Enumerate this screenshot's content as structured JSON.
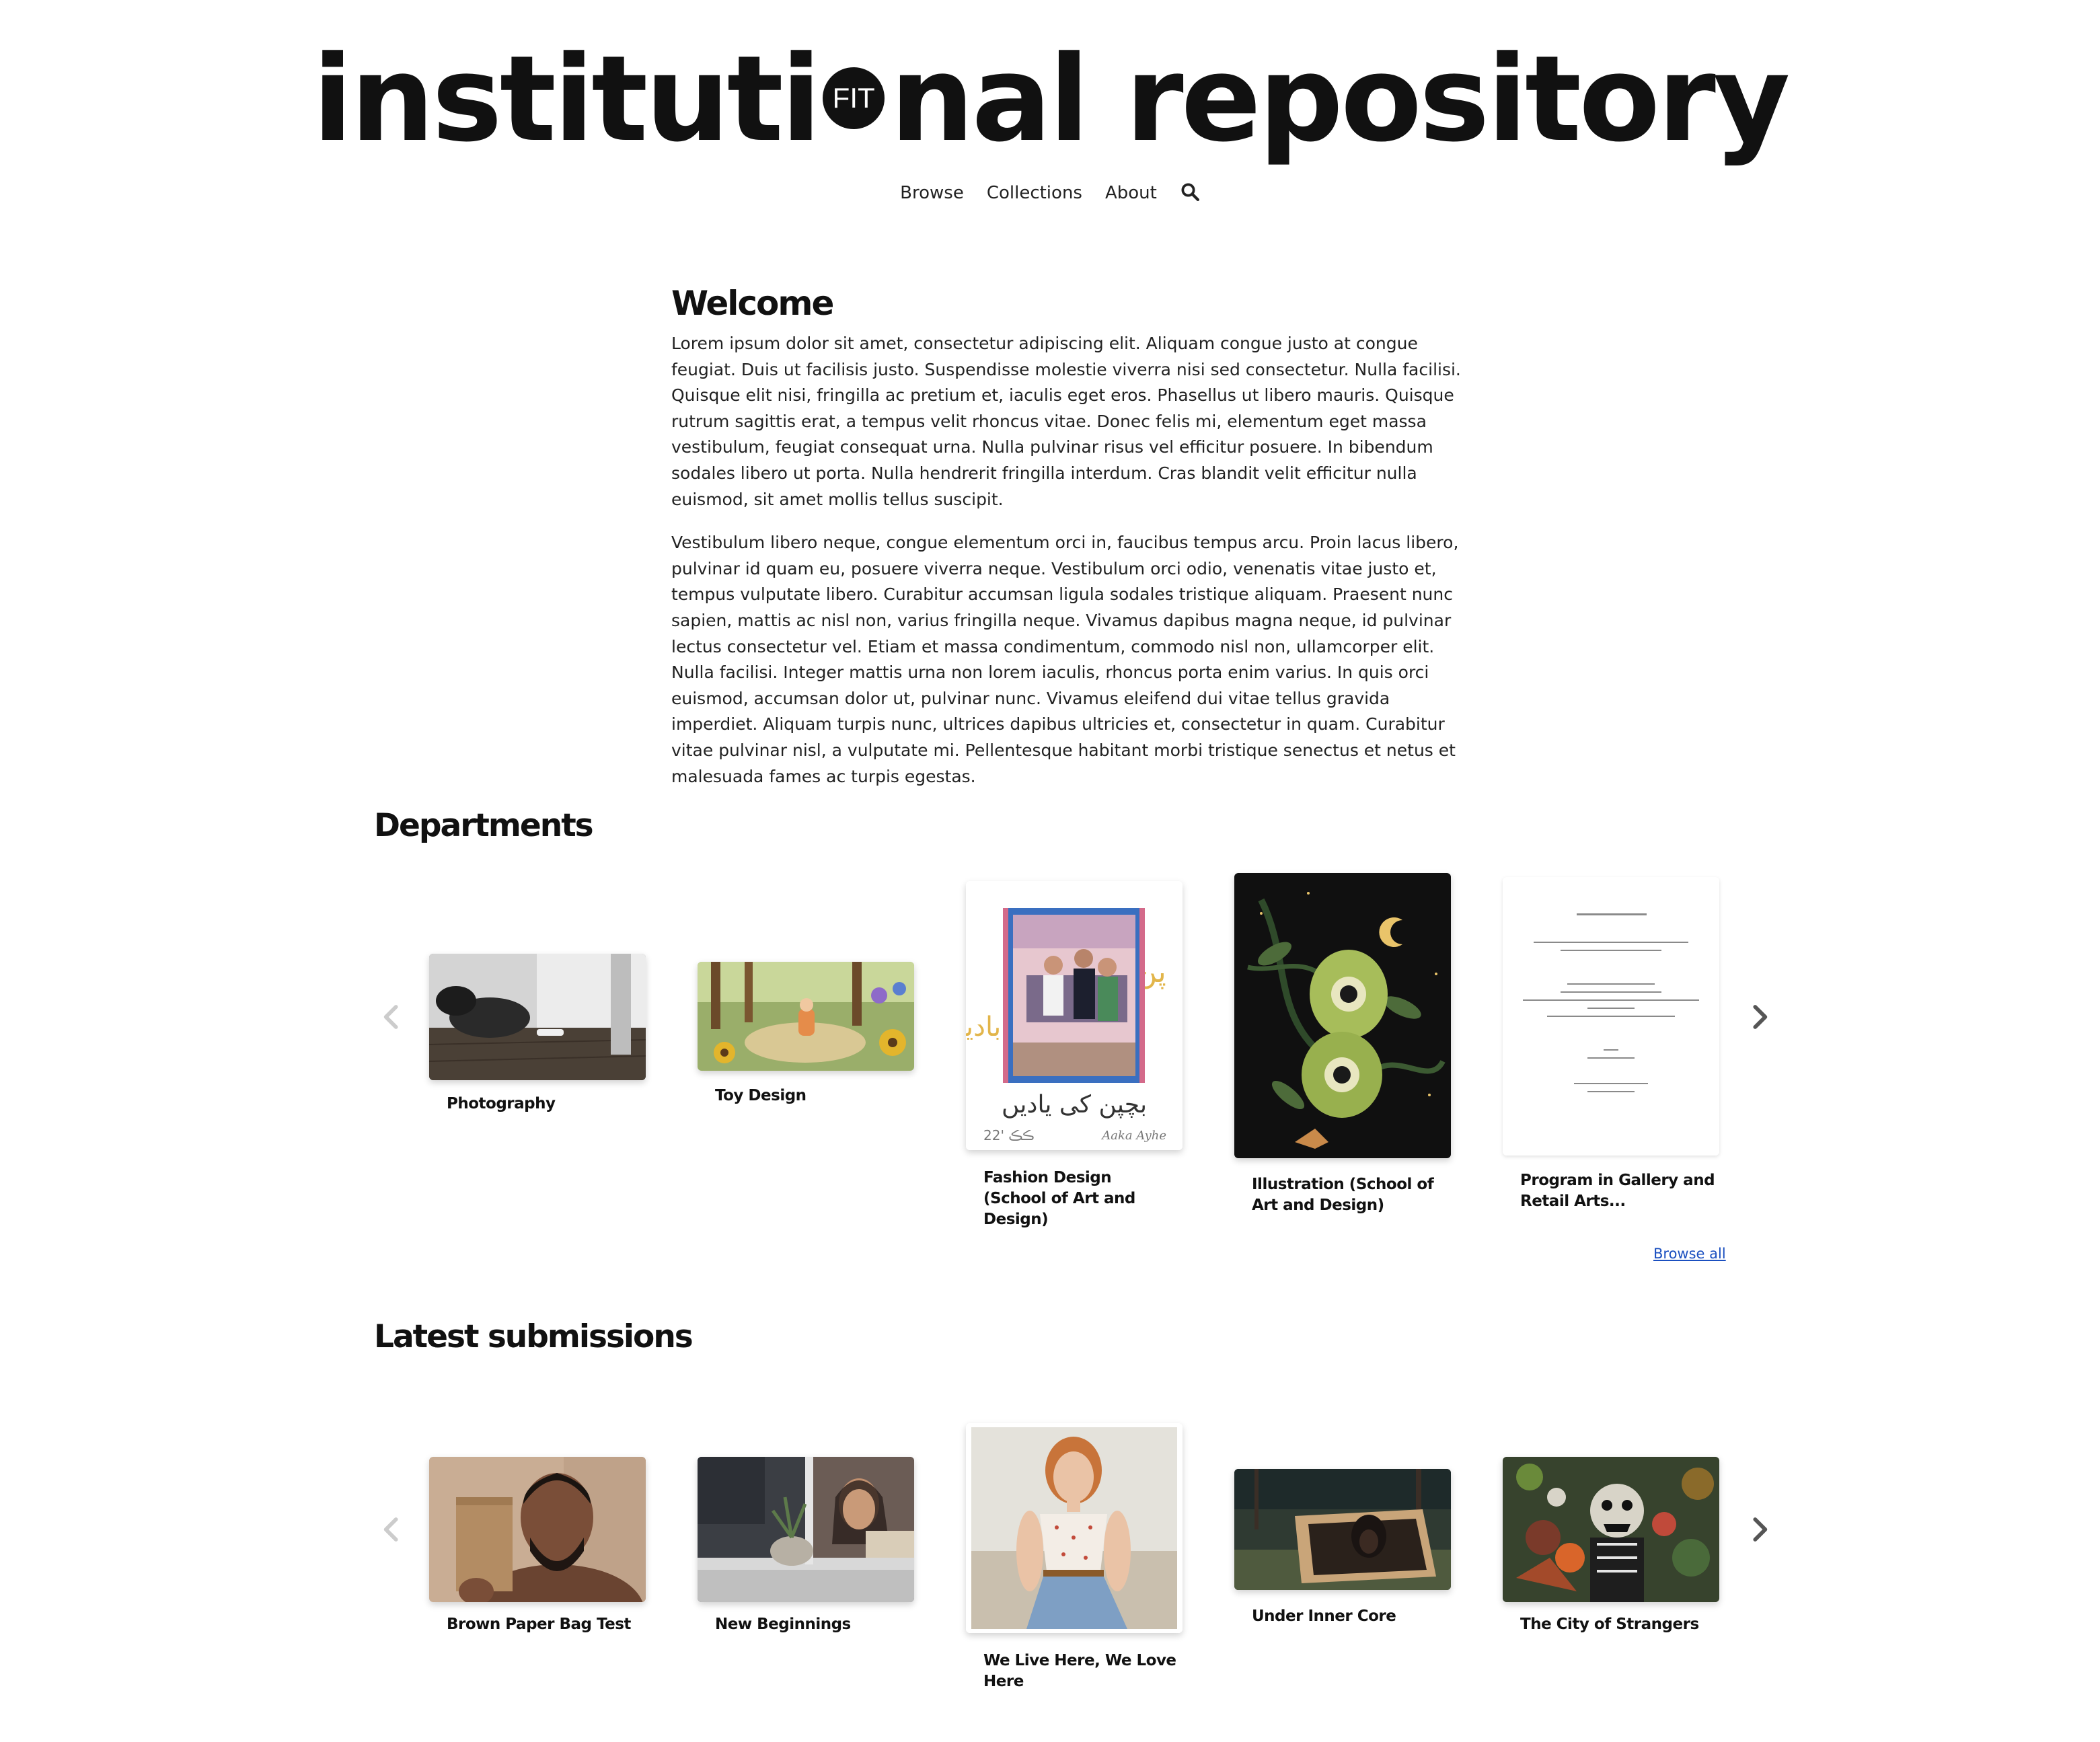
{
  "header": {
    "logo_left": "instituti",
    "logo_mark": "FIT",
    "logo_right": "nal repository"
  },
  "nav": {
    "items": [
      "Browse",
      "Collections",
      "About"
    ],
    "search_icon": "search-icon"
  },
  "welcome": {
    "title": "Welcome",
    "paragraph_1": "Lorem ipsum dolor sit amet, consectetur adipiscing elit. Aliquam congue justo at congue feugiat. Duis ut facilisis justo. Suspendisse molestie viverra nisi sed consectetur. Nulla facilisi. Quisque elit nisi, fringilla ac pretium et, iaculis eget eros. Phasellus ut libero mauris. Quisque rutrum sagittis erat, a tempus velit rhoncus vitae. Donec felis mi, elementum eget massa vestibulum, feugiat consequat urna. Nulla pulvinar risus vel efficitur posuere. In bibendum sodales libero ut porta. Nulla hendrerit fringilla interdum. Cras blandit velit efficitur nulla euismod, sit amet mollis tellus suscipit.",
    "paragraph_2": "Vestibulum libero neque, congue elementum orci in, faucibus tempus arcu. Proin lacus libero, pulvinar id quam eu, posuere viverra neque. Vestibulum orci odio, venenatis vitae justo et, tempus vulputate libero. Curabitur accumsan ligula sodales tristique aliquam. Praesent nunc sapien, mattis ac nisl non, varius fringilla neque. Vivamus dapibus magna neque, id pulvinar lectus consectetur vel. Etiam et massa condimentum, commodo nisl non, ullamcorper elit. Nulla facilisi. Integer mattis urna non lorem iaculis, rhoncus porta enim varius. In quis orci euismod, accumsan dolor ut, pulvinar nunc. Vivamus eleifend dui vitae tellus gravida imperdiet. Aliquam turpis nunc, ultrices dapibus ultricies et, consectetur in quam. Curabitur vitae pulvinar nisl, a vulputate mi. Pellentesque habitant morbi tristique senectus et netus et malesuada fames ac turpis egestas."
  },
  "departments": {
    "title": "Departments",
    "items": [
      {
        "label": "Photography"
      },
      {
        "label": "Toy Design"
      },
      {
        "label": "Fashion Design (School of Art and Design)",
        "poster_text": "بچپن کی یادیں",
        "poster_footer_left": "ڪڪ '22",
        "poster_footer_right": "Aaka Ayhe"
      },
      {
        "label": "Illustration (School of Art and Design)"
      },
      {
        "label": "Program in Gallery and Retail Arts..."
      }
    ],
    "browse_all": "Browse all",
    "prev_icon": "chevron-left-icon",
    "next_icon": "chevron-right-icon"
  },
  "latest": {
    "title": "Latest submissions",
    "items": [
      {
        "label": "Brown Paper Bag Test"
      },
      {
        "label": "New Beginnings"
      },
      {
        "label": "We Live Here, We Love Here"
      },
      {
        "label": "Under Inner Core"
      },
      {
        "label": "The City of Strangers"
      }
    ],
    "prev_icon": "chevron-left-icon",
    "next_icon": "chevron-right-icon"
  },
  "colors": {
    "text": "#111111",
    "link": "#1a4fc0",
    "arrow_active": "#555555",
    "arrow_disabled": "#cccccc"
  }
}
